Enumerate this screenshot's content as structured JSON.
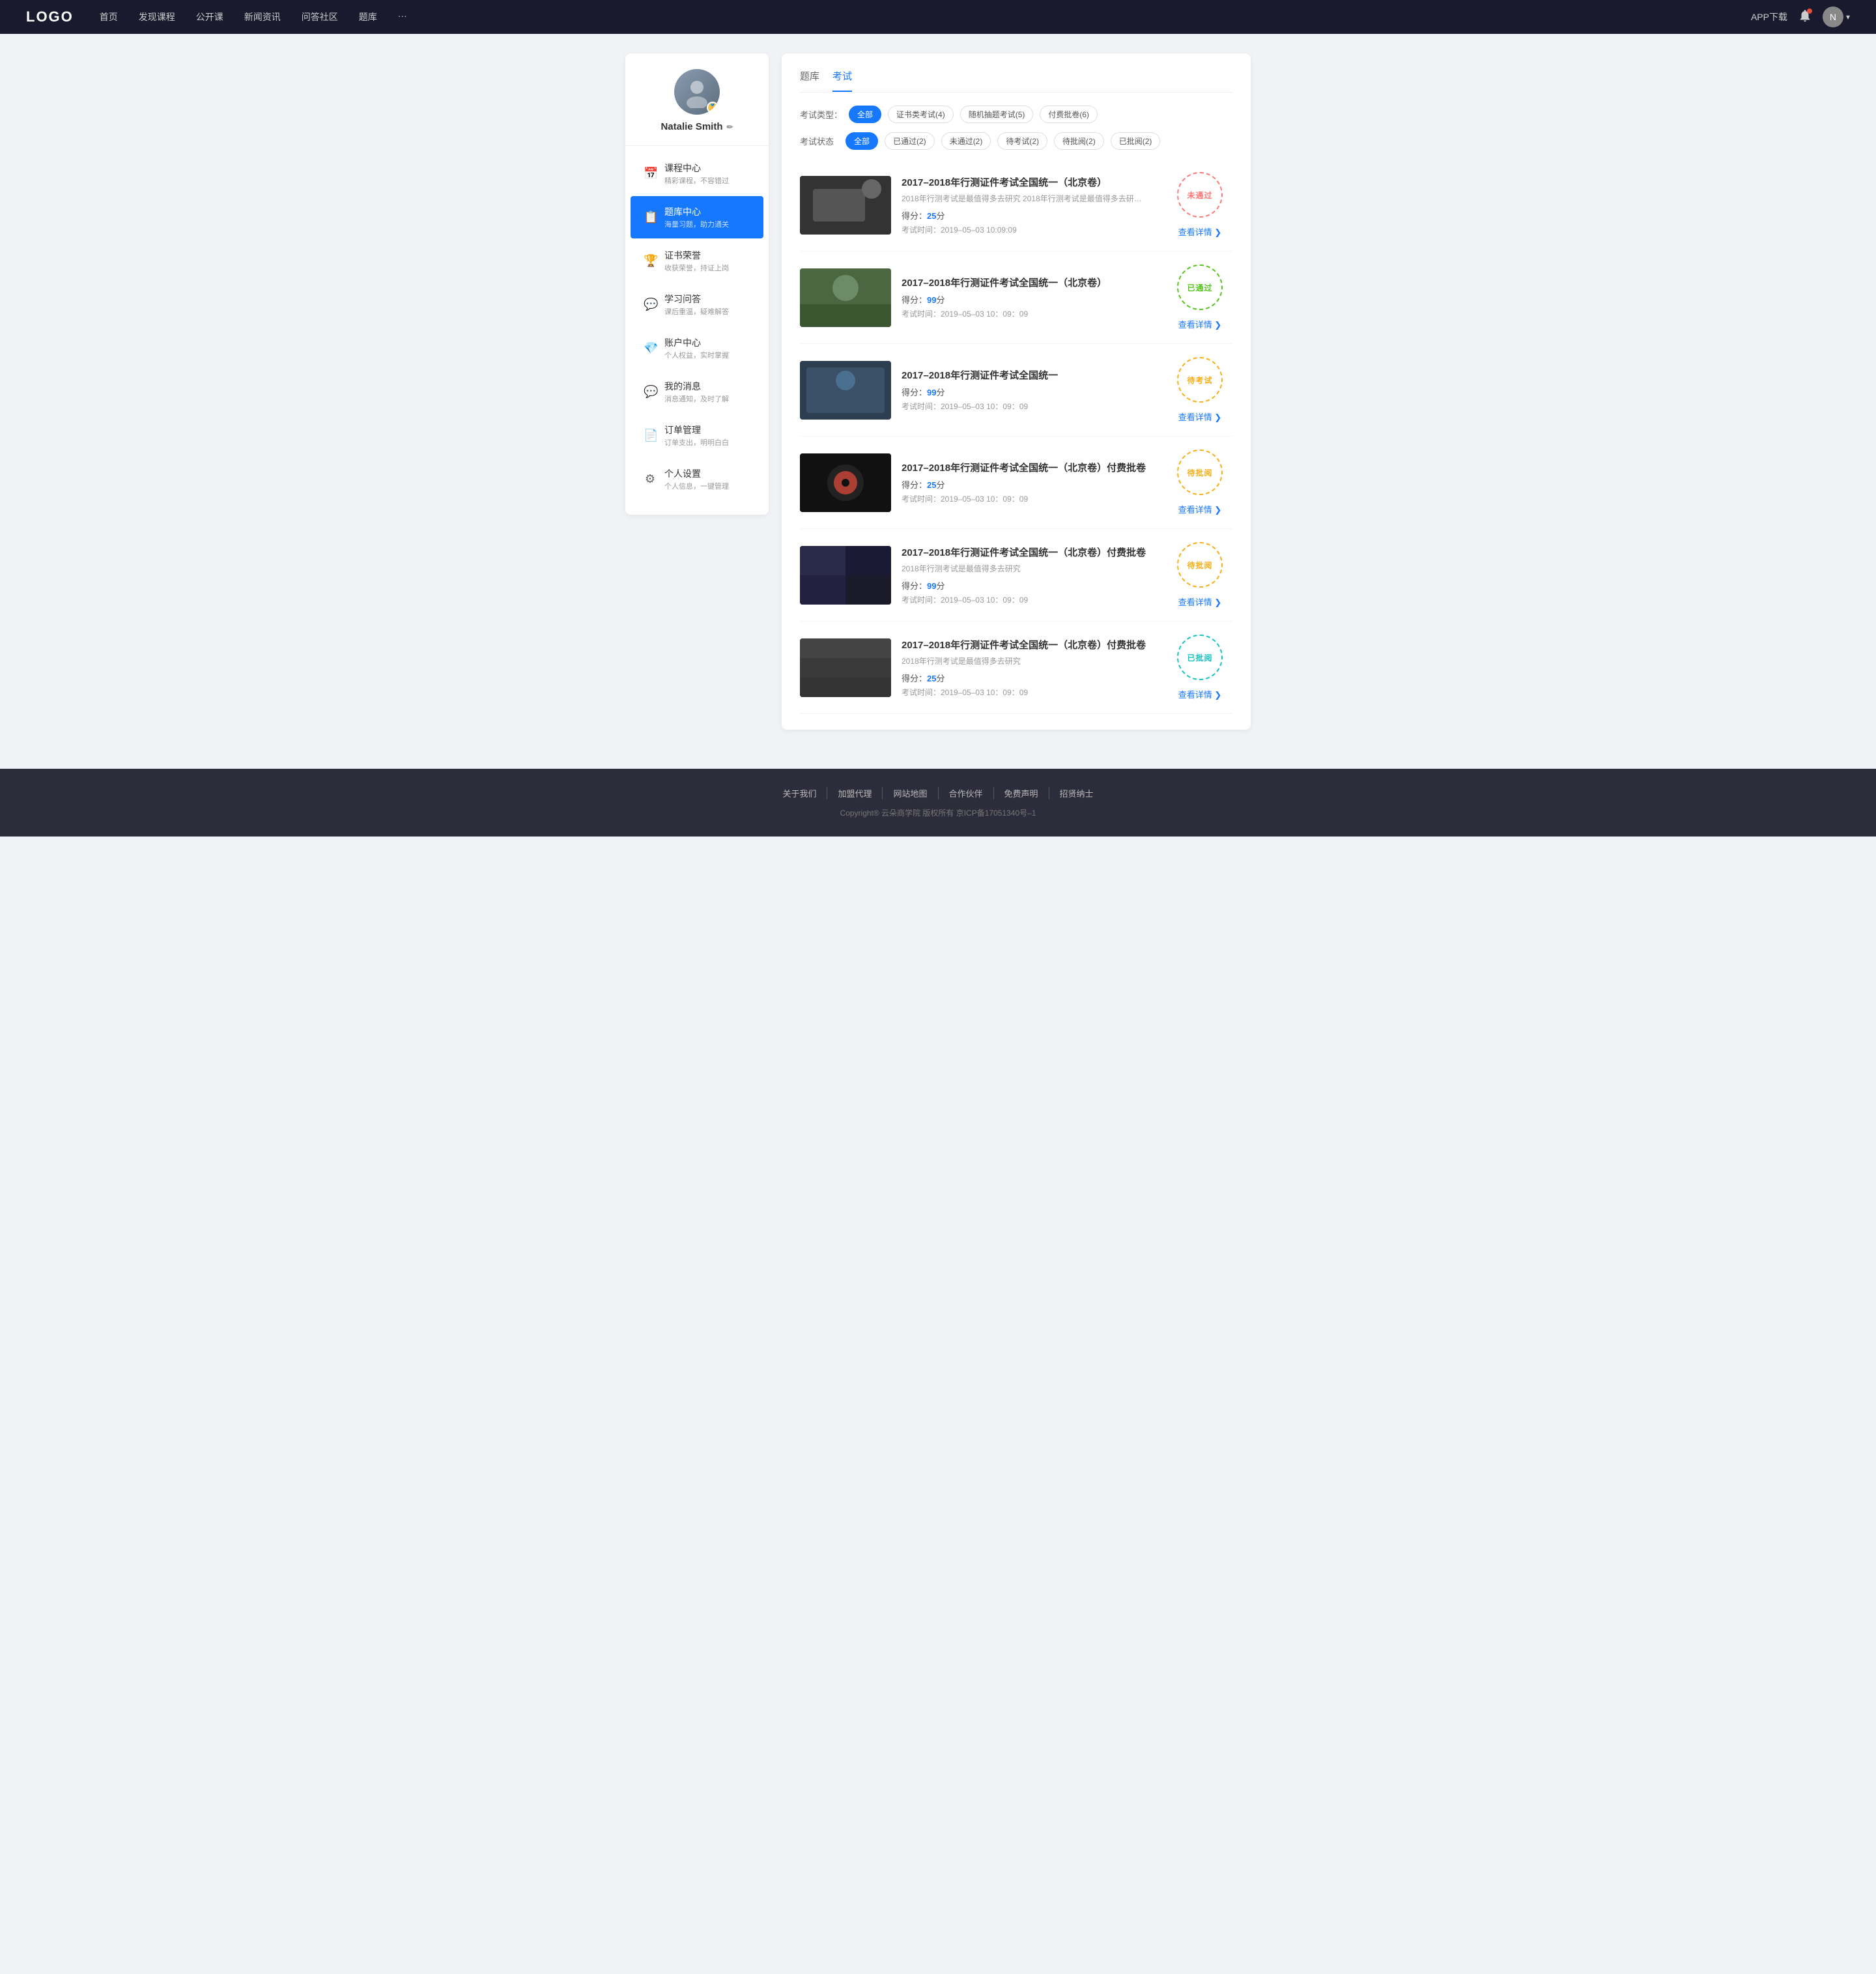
{
  "navbar": {
    "logo": "LOGO",
    "nav_items": [
      "首页",
      "发现课程",
      "公开课",
      "新闻资讯",
      "问答社区",
      "题库",
      "···"
    ],
    "app_download": "APP下载",
    "avatar_initial": "N"
  },
  "sidebar": {
    "profile": {
      "name": "Natalie Smith",
      "edit_label": "✏",
      "avatar_icon": "👤",
      "badge_icon": "🏅"
    },
    "menu": [
      {
        "id": "courses",
        "title": "课程中心",
        "subtitle": "精彩课程，不容错过",
        "icon": "📅"
      },
      {
        "id": "question-bank",
        "title": "题库中心",
        "subtitle": "海量习题，助力通关",
        "icon": "📋",
        "active": true
      },
      {
        "id": "certificates",
        "title": "证书荣誉",
        "subtitle": "收获荣誉，持证上岗",
        "icon": "🏆"
      },
      {
        "id": "qa",
        "title": "学习问答",
        "subtitle": "课后重温，疑难解答",
        "icon": "💬"
      },
      {
        "id": "account",
        "title": "账户中心",
        "subtitle": "个人权益，实时掌握",
        "icon": "💎"
      },
      {
        "id": "messages",
        "title": "我的消息",
        "subtitle": "消息通知，及时了解",
        "icon": "💬"
      },
      {
        "id": "orders",
        "title": "订单管理",
        "subtitle": "订单支出，明明白白",
        "icon": "📄"
      },
      {
        "id": "settings",
        "title": "个人设置",
        "subtitle": "个人信息，一键管理",
        "icon": "⚙"
      }
    ]
  },
  "content": {
    "tabs": [
      "题库",
      "考试"
    ],
    "active_tab": "考试",
    "filter_type": {
      "label": "考试类型：",
      "options": [
        {
          "label": "全部",
          "active": true
        },
        {
          "label": "证书类考试(4)",
          "active": false
        },
        {
          "label": "随机抽题考试(5)",
          "active": false
        },
        {
          "label": "付费批卷(6)",
          "active": false
        }
      ]
    },
    "filter_status": {
      "label": "考试状态",
      "options": [
        {
          "label": "全部",
          "active": true
        },
        {
          "label": "已通过(2)",
          "active": false
        },
        {
          "label": "未通过(2)",
          "active": false
        },
        {
          "label": "待考试(2)",
          "active": false
        },
        {
          "label": "待批阅(2)",
          "active": false
        },
        {
          "label": "已批阅(2)",
          "active": false
        }
      ]
    },
    "exams": [
      {
        "id": 1,
        "title": "2017–2018年行测证件考试全国统一（北京卷）",
        "desc": "2018年行测考试是最值得多去研究 2018年行测考试是最值得多去研究 2018年行…",
        "score_label": "得分：",
        "score": "25",
        "score_unit": "分",
        "time_label": "考试时间：",
        "exam_time": "2019–05–03  10:09:09",
        "status": "未通过",
        "status_type": "failed",
        "detail_link": "查看详情",
        "thumb_class": "thumb-1"
      },
      {
        "id": 2,
        "title": "2017–2018年行测证件考试全国统一（北京卷）",
        "desc": "",
        "score_label": "得分：",
        "score": "99",
        "score_unit": "分",
        "time_label": "考试时间：",
        "exam_time": "2019–05–03  10：09：09",
        "status": "已通过",
        "status_type": "passed",
        "detail_link": "查看详情",
        "thumb_class": "thumb-2"
      },
      {
        "id": 3,
        "title": "2017–2018年行测证件考试全国统一",
        "desc": "",
        "score_label": "得分：",
        "score": "99",
        "score_unit": "分",
        "time_label": "考试时间：",
        "exam_time": "2019–05–03  10：09：09",
        "status": "待考试",
        "status_type": "pending",
        "detail_link": "查看详情",
        "thumb_class": "thumb-3"
      },
      {
        "id": 4,
        "title": "2017–2018年行测证件考试全国统一（北京卷）付费批卷",
        "desc": "",
        "score_label": "得分：",
        "score": "25",
        "score_unit": "分",
        "time_label": "考试时间：",
        "exam_time": "2019–05–03  10：09：09",
        "status": "待批阅",
        "status_type": "pending",
        "detail_link": "查看详情",
        "thumb_class": "thumb-4"
      },
      {
        "id": 5,
        "title": "2017–2018年行测证件考试全国统一（北京卷）付费批卷",
        "desc": "2018年行测考试是最值得多去研究",
        "score_label": "得分：",
        "score": "99",
        "score_unit": "分",
        "time_label": "考试时间：",
        "exam_time": "2019–05–03  10：09：09",
        "status": "待批阅",
        "status_type": "pending",
        "detail_link": "查看详情",
        "thumb_class": "thumb-5"
      },
      {
        "id": 6,
        "title": "2017–2018年行测证件考试全国统一（北京卷）付费批卷",
        "desc": "2018年行测考试是最值得多去研究",
        "score_label": "得分：",
        "score": "25",
        "score_unit": "分",
        "time_label": "考试时间：",
        "exam_time": "2019–05–03  10：09：09",
        "status": "已批阅",
        "status_type": "reviewed",
        "detail_link": "查看详情",
        "thumb_class": "thumb-6"
      }
    ]
  },
  "footer": {
    "links": [
      "关于我们",
      "加盟代理",
      "网站地图",
      "合作伙伴",
      "免费声明",
      "招贤纳士"
    ],
    "copyright": "Copyright® 云朵商学院  版权所有    京ICP备17051340号–1"
  }
}
